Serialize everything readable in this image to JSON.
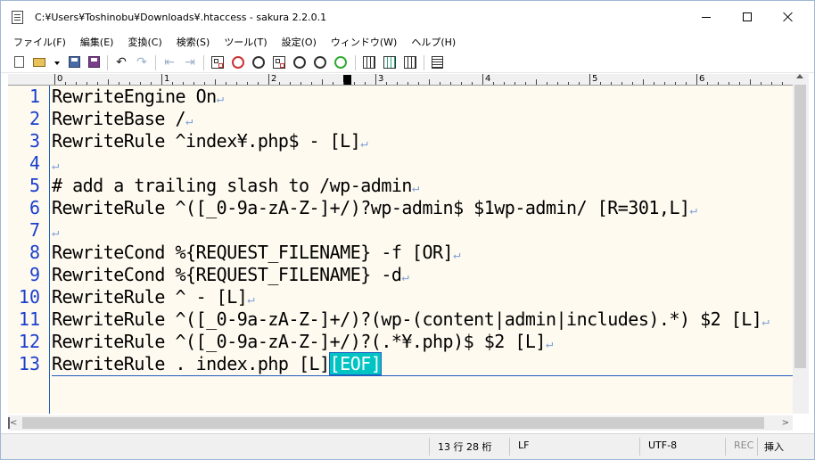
{
  "window": {
    "title": "C:¥Users¥Toshinobu¥Downloads¥.htaccess - sakura 2.2.0.1"
  },
  "menu": {
    "items": [
      "ファイル(F)",
      "編集(E)",
      "変換(C)",
      "検索(S)",
      "ツール(T)",
      "設定(O)",
      "ウィンドウ(W)",
      "ヘルプ(H)"
    ]
  },
  "toolbar": {
    "undo_glyph": "↶",
    "redo_glyph": "↷",
    "back_glyph": "⇤",
    "forward_glyph": "⇥",
    "icons": [
      "new-file-icon",
      "open-file-icon",
      "save-icon",
      "save-all-icon",
      "undo-icon",
      "redo-icon",
      "jump-back-icon",
      "jump-forward-icon",
      "search-icon",
      "search-next-icon",
      "search-prev-icon",
      "replace-icon",
      "grep-icon",
      "compare-icon",
      "outline-icon",
      "settings-icon",
      "type-settings-icon",
      "font-icon"
    ]
  },
  "ruler": {
    "labels": [
      "0",
      "1",
      "2",
      "3",
      "4",
      "5",
      "6"
    ]
  },
  "editor": {
    "line_numbers": [
      "1",
      "2",
      "3",
      "4",
      "5",
      "6",
      "7",
      "8",
      "9",
      "10",
      "11",
      "12",
      "13"
    ],
    "lines": [
      "RewriteEngine On",
      "RewriteBase /",
      "RewriteRule ^index¥.php$ - [L]",
      "",
      "# add a trailing slash to /wp-admin",
      "RewriteRule ^([_0-9a-zA-Z-]+/)?wp-admin$ $1wp-admin/ [R=301,L]",
      "",
      "RewriteCond %{REQUEST_FILENAME} -f [OR]",
      "RewriteCond %{REQUEST_FILENAME} -d",
      "RewriteRule ^ - [L]",
      "RewriteRule ^([_0-9a-zA-Z-]+/)?(wp-(content|admin|includes).*) $2 [L]",
      "RewriteRule ^([_0-9a-zA-Z-]+/)?(.*¥.php)$ $2 [L]",
      "RewriteRule . index.php [L]"
    ],
    "eol_mark": "↵",
    "eof_mark": "[EOF]",
    "background_color": "#fffaf0",
    "line_number_color": "#1a3fcc"
  },
  "statusbar": {
    "position": "13 行  28 桁",
    "line_ending": "LF",
    "encoding": "UTF-8",
    "rec": "REC",
    "insert_mode": "挿入"
  }
}
